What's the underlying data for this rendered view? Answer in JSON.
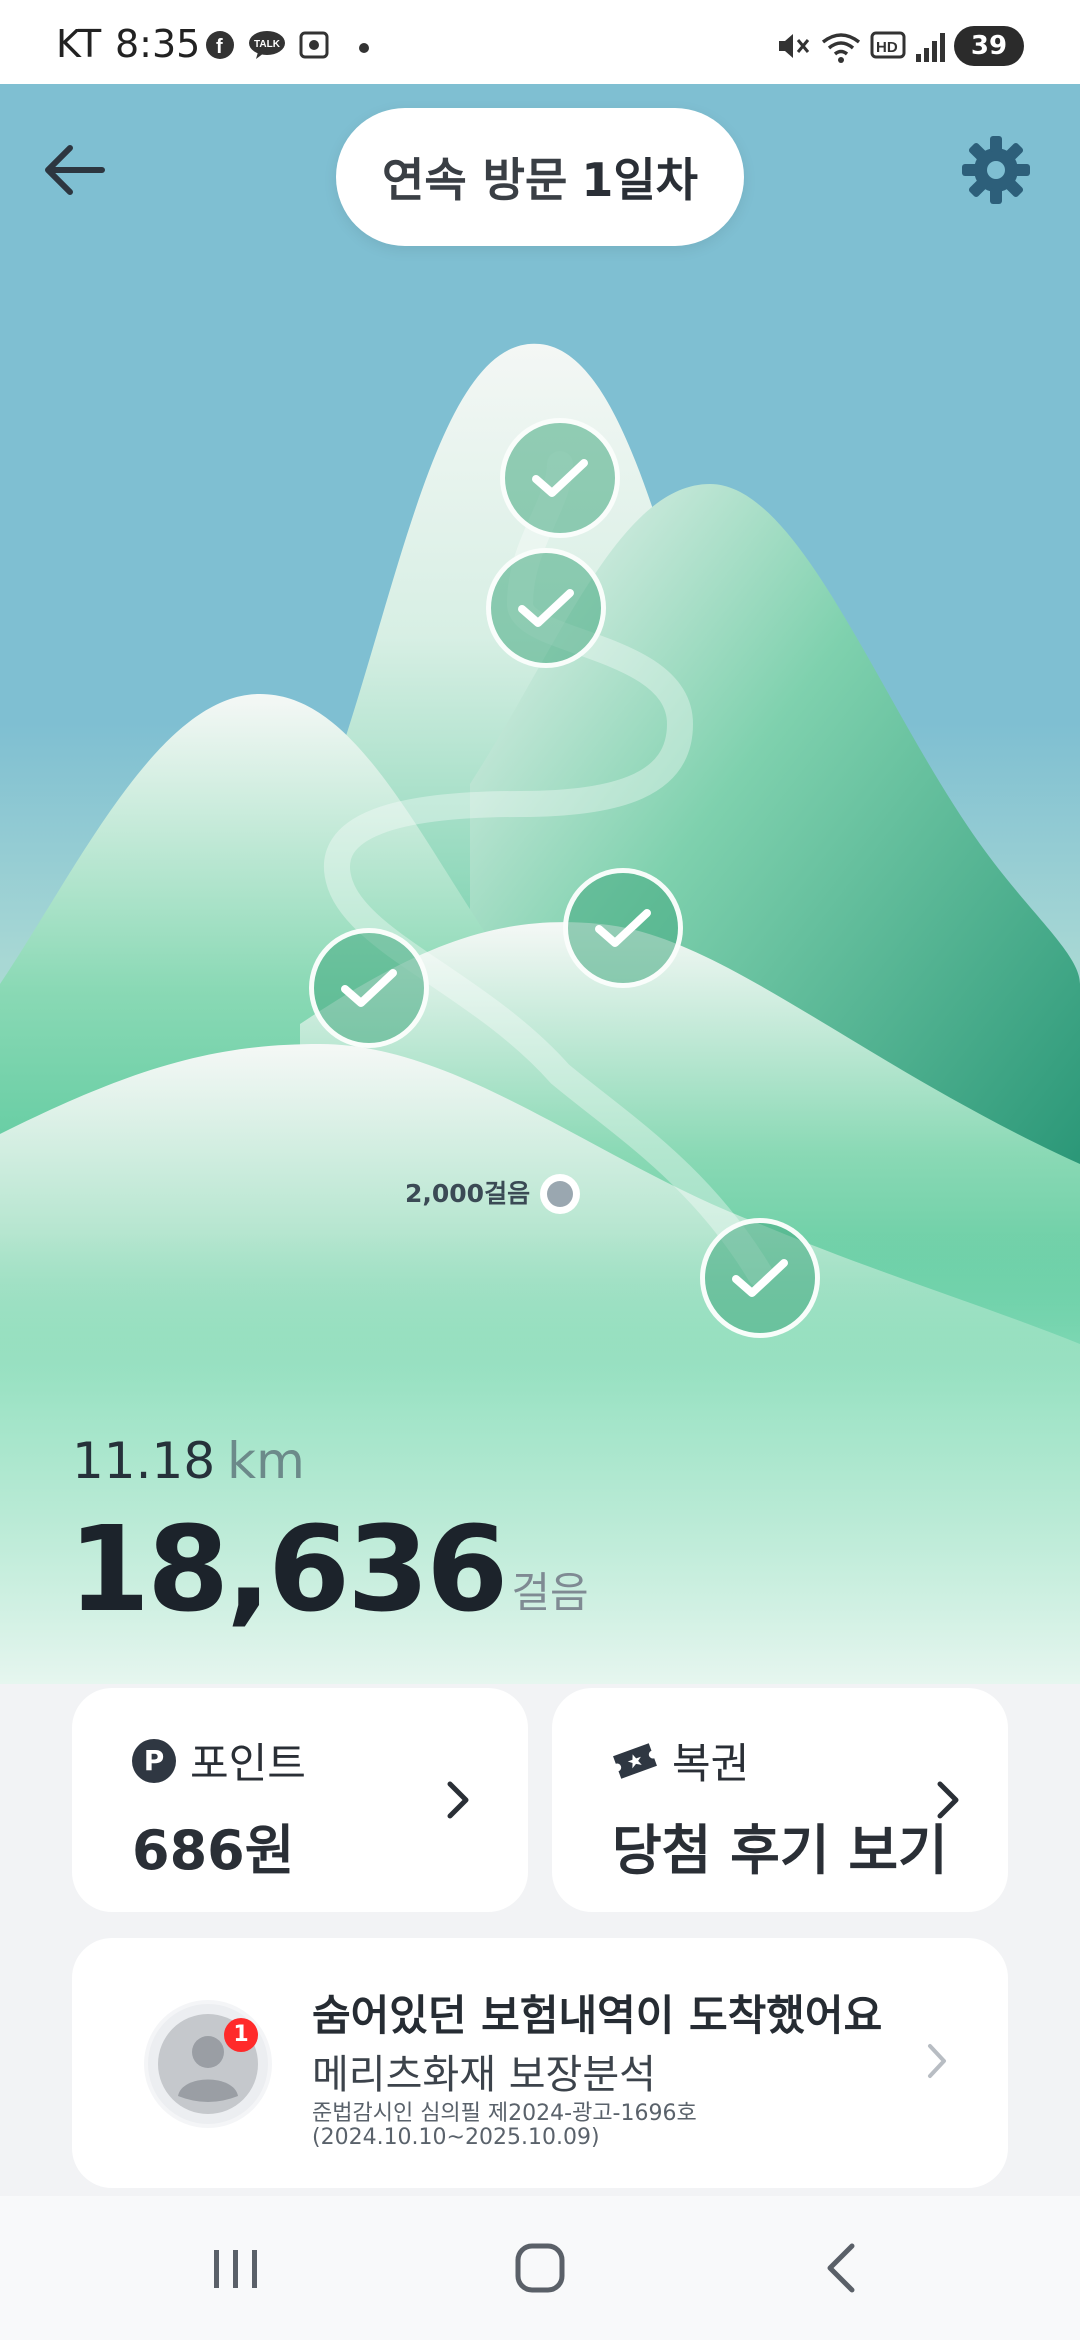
{
  "status_bar": {
    "carrier": "KT",
    "time": "8:35",
    "battery": "39",
    "notification_icons": [
      "facebook-icon",
      "kakaotalk-icon",
      "screenshot-icon",
      "dot-icon"
    ],
    "system_icons": [
      "mute-icon",
      "wifi-icon",
      "hd-icon",
      "signal-icon"
    ]
  },
  "header": {
    "visit_label": "연속 방문",
    "visit_day": "1일차",
    "back_icon": "arrow-left-icon",
    "settings_icon": "gear-icon"
  },
  "map": {
    "step_marker_label": "2,000걸음",
    "checkpoint_count": 6
  },
  "stats": {
    "distance_value": "11.18",
    "distance_unit": "km",
    "steps_value": "18,636",
    "steps_unit": "걸음"
  },
  "points_card": {
    "icon": "P",
    "label": "포인트",
    "value": "686원"
  },
  "lotto_card": {
    "icon": "ticket-icon",
    "label": "복권",
    "value": "당첨 후기 보기"
  },
  "insurance_card": {
    "badge_count": "1",
    "title": "숨어있던 보험내역이 도착했어요",
    "subtitle": "메리츠화재 보장분석",
    "legal_line1": "준법감시인 심의필 제2024-광고-1696호",
    "legal_line2": "(2024.10.10~2025.10.09)"
  },
  "colors": {
    "sky": "#7fbfd2",
    "mountain_green": "#3cbf8c",
    "card_bg": "#ffffff",
    "page_bg": "#f2f3f5",
    "badge_red": "#ff2a2a"
  }
}
